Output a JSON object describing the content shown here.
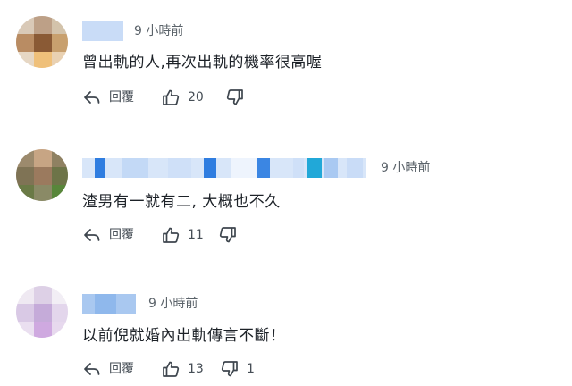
{
  "comments": [
    {
      "time": "9 小時前",
      "text": "曾出軌的人,再次出軌的機率很高喔",
      "reply_label": "回覆",
      "like_count": "20",
      "dislike_count": ""
    },
    {
      "time": "9 小時前",
      "text": "渣男有一就有二, 大概也不久",
      "reply_label": "回覆",
      "like_count": "11",
      "dislike_count": ""
    },
    {
      "time": "9 小時前",
      "text": "以前倪就婚內出軌傳言不斷！",
      "reply_label": "回覆",
      "like_count": "13",
      "dislike_count": "1"
    }
  ],
  "icons": {
    "reply": "reply-arrow-icon",
    "like": "thumbs-up-icon",
    "dislike": "thumbs-down-icon"
  },
  "colors": {
    "name_blur_light": "#c9dcf7",
    "name_blur_accent": "#2f7de0",
    "name_blur_cyan": "#21a8d8",
    "text": "#1d2228",
    "meta": "#5b636a"
  }
}
